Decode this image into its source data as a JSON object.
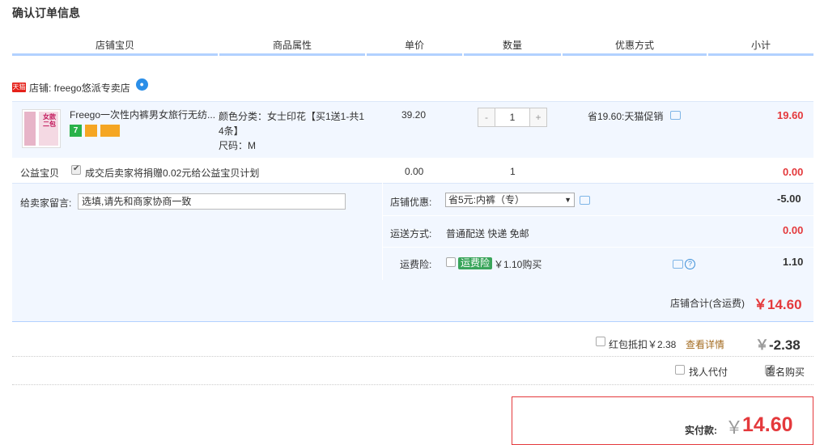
{
  "page_title": "确认订单信息",
  "columns": [
    "店铺宝贝",
    "商品属性",
    "单价",
    "数量",
    "优惠方式",
    "小计"
  ],
  "shop": {
    "badge": "天猫",
    "label": "店铺: freego悠派专卖店",
    "ww_icon": "ww-chat-icon"
  },
  "item": {
    "thumb_text": "女款二包",
    "name": "Freego一次性内裤男女旅行无纺...",
    "badges": [
      "7",
      "",
      ""
    ],
    "attr_line1": "颜色分类：女士印花【买1送1-共1",
    "attr_line2": "4条】",
    "attr_line3": "尺码：M",
    "price": "39.20",
    "quantity": "1",
    "minus": "-",
    "plus": "+",
    "promo": "省19.60:天猫促销",
    "subtotal": "19.60"
  },
  "welfare": {
    "label": "公益宝贝",
    "text": "成交后卖家将捐赠0.02元给公益宝贝计划",
    "price": "0.00",
    "quantity": "1",
    "subtotal": "0.00"
  },
  "message": {
    "label": "给卖家留言:",
    "placeholder": "选填,请先和商家协商一致"
  },
  "shop_discount": {
    "label": "店铺优惠:",
    "selected": "省5元:内裤（专）",
    "amount": "-5.00"
  },
  "shipping": {
    "label": "运送方式:",
    "value": "普通配送 快递 免邮",
    "amount": "0.00"
  },
  "insurance": {
    "label": "运费险:",
    "tag": "运费险",
    "price": "￥1.10购买",
    "amount": "1.10"
  },
  "shop_total": {
    "label": "店铺合计(含运费)",
    "amount": "￥14.60"
  },
  "red_packet": {
    "label": "红包抵扣￥2.38",
    "link": "查看详情",
    "amount_sign": "￥",
    "amount": "-2.38"
  },
  "options": {
    "proxy_pay": "找人代付",
    "anonymous": "匿名购买"
  },
  "payment": {
    "label": "实付款:",
    "currency": "￥",
    "amount": "14.60"
  }
}
